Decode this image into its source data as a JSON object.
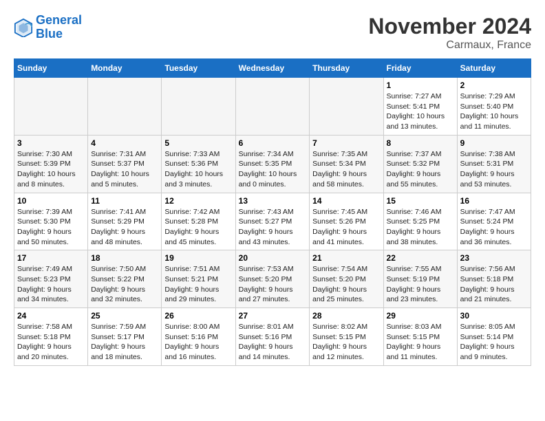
{
  "header": {
    "logo_line1": "General",
    "logo_line2": "Blue",
    "month": "November 2024",
    "location": "Carmaux, France"
  },
  "weekdays": [
    "Sunday",
    "Monday",
    "Tuesday",
    "Wednesday",
    "Thursday",
    "Friday",
    "Saturday"
  ],
  "weeks": [
    [
      {
        "day": "",
        "info": ""
      },
      {
        "day": "",
        "info": ""
      },
      {
        "day": "",
        "info": ""
      },
      {
        "day": "",
        "info": ""
      },
      {
        "day": "",
        "info": ""
      },
      {
        "day": "1",
        "info": "Sunrise: 7:27 AM\nSunset: 5:41 PM\nDaylight: 10 hours\nand 13 minutes."
      },
      {
        "day": "2",
        "info": "Sunrise: 7:29 AM\nSunset: 5:40 PM\nDaylight: 10 hours\nand 11 minutes."
      }
    ],
    [
      {
        "day": "3",
        "info": "Sunrise: 7:30 AM\nSunset: 5:39 PM\nDaylight: 10 hours\nand 8 minutes."
      },
      {
        "day": "4",
        "info": "Sunrise: 7:31 AM\nSunset: 5:37 PM\nDaylight: 10 hours\nand 5 minutes."
      },
      {
        "day": "5",
        "info": "Sunrise: 7:33 AM\nSunset: 5:36 PM\nDaylight: 10 hours\nand 3 minutes."
      },
      {
        "day": "6",
        "info": "Sunrise: 7:34 AM\nSunset: 5:35 PM\nDaylight: 10 hours\nand 0 minutes."
      },
      {
        "day": "7",
        "info": "Sunrise: 7:35 AM\nSunset: 5:34 PM\nDaylight: 9 hours\nand 58 minutes."
      },
      {
        "day": "8",
        "info": "Sunrise: 7:37 AM\nSunset: 5:32 PM\nDaylight: 9 hours\nand 55 minutes."
      },
      {
        "day": "9",
        "info": "Sunrise: 7:38 AM\nSunset: 5:31 PM\nDaylight: 9 hours\nand 53 minutes."
      }
    ],
    [
      {
        "day": "10",
        "info": "Sunrise: 7:39 AM\nSunset: 5:30 PM\nDaylight: 9 hours\nand 50 minutes."
      },
      {
        "day": "11",
        "info": "Sunrise: 7:41 AM\nSunset: 5:29 PM\nDaylight: 9 hours\nand 48 minutes."
      },
      {
        "day": "12",
        "info": "Sunrise: 7:42 AM\nSunset: 5:28 PM\nDaylight: 9 hours\nand 45 minutes."
      },
      {
        "day": "13",
        "info": "Sunrise: 7:43 AM\nSunset: 5:27 PM\nDaylight: 9 hours\nand 43 minutes."
      },
      {
        "day": "14",
        "info": "Sunrise: 7:45 AM\nSunset: 5:26 PM\nDaylight: 9 hours\nand 41 minutes."
      },
      {
        "day": "15",
        "info": "Sunrise: 7:46 AM\nSunset: 5:25 PM\nDaylight: 9 hours\nand 38 minutes."
      },
      {
        "day": "16",
        "info": "Sunrise: 7:47 AM\nSunset: 5:24 PM\nDaylight: 9 hours\nand 36 minutes."
      }
    ],
    [
      {
        "day": "17",
        "info": "Sunrise: 7:49 AM\nSunset: 5:23 PM\nDaylight: 9 hours\nand 34 minutes."
      },
      {
        "day": "18",
        "info": "Sunrise: 7:50 AM\nSunset: 5:22 PM\nDaylight: 9 hours\nand 32 minutes."
      },
      {
        "day": "19",
        "info": "Sunrise: 7:51 AM\nSunset: 5:21 PM\nDaylight: 9 hours\nand 29 minutes."
      },
      {
        "day": "20",
        "info": "Sunrise: 7:53 AM\nSunset: 5:20 PM\nDaylight: 9 hours\nand 27 minutes."
      },
      {
        "day": "21",
        "info": "Sunrise: 7:54 AM\nSunset: 5:20 PM\nDaylight: 9 hours\nand 25 minutes."
      },
      {
        "day": "22",
        "info": "Sunrise: 7:55 AM\nSunset: 5:19 PM\nDaylight: 9 hours\nand 23 minutes."
      },
      {
        "day": "23",
        "info": "Sunrise: 7:56 AM\nSunset: 5:18 PM\nDaylight: 9 hours\nand 21 minutes."
      }
    ],
    [
      {
        "day": "24",
        "info": "Sunrise: 7:58 AM\nSunset: 5:18 PM\nDaylight: 9 hours\nand 20 minutes."
      },
      {
        "day": "25",
        "info": "Sunrise: 7:59 AM\nSunset: 5:17 PM\nDaylight: 9 hours\nand 18 minutes."
      },
      {
        "day": "26",
        "info": "Sunrise: 8:00 AM\nSunset: 5:16 PM\nDaylight: 9 hours\nand 16 minutes."
      },
      {
        "day": "27",
        "info": "Sunrise: 8:01 AM\nSunset: 5:16 PM\nDaylight: 9 hours\nand 14 minutes."
      },
      {
        "day": "28",
        "info": "Sunrise: 8:02 AM\nSunset: 5:15 PM\nDaylight: 9 hours\nand 12 minutes."
      },
      {
        "day": "29",
        "info": "Sunrise: 8:03 AM\nSunset: 5:15 PM\nDaylight: 9 hours\nand 11 minutes."
      },
      {
        "day": "30",
        "info": "Sunrise: 8:05 AM\nSunset: 5:14 PM\nDaylight: 9 hours\nand 9 minutes."
      }
    ]
  ]
}
